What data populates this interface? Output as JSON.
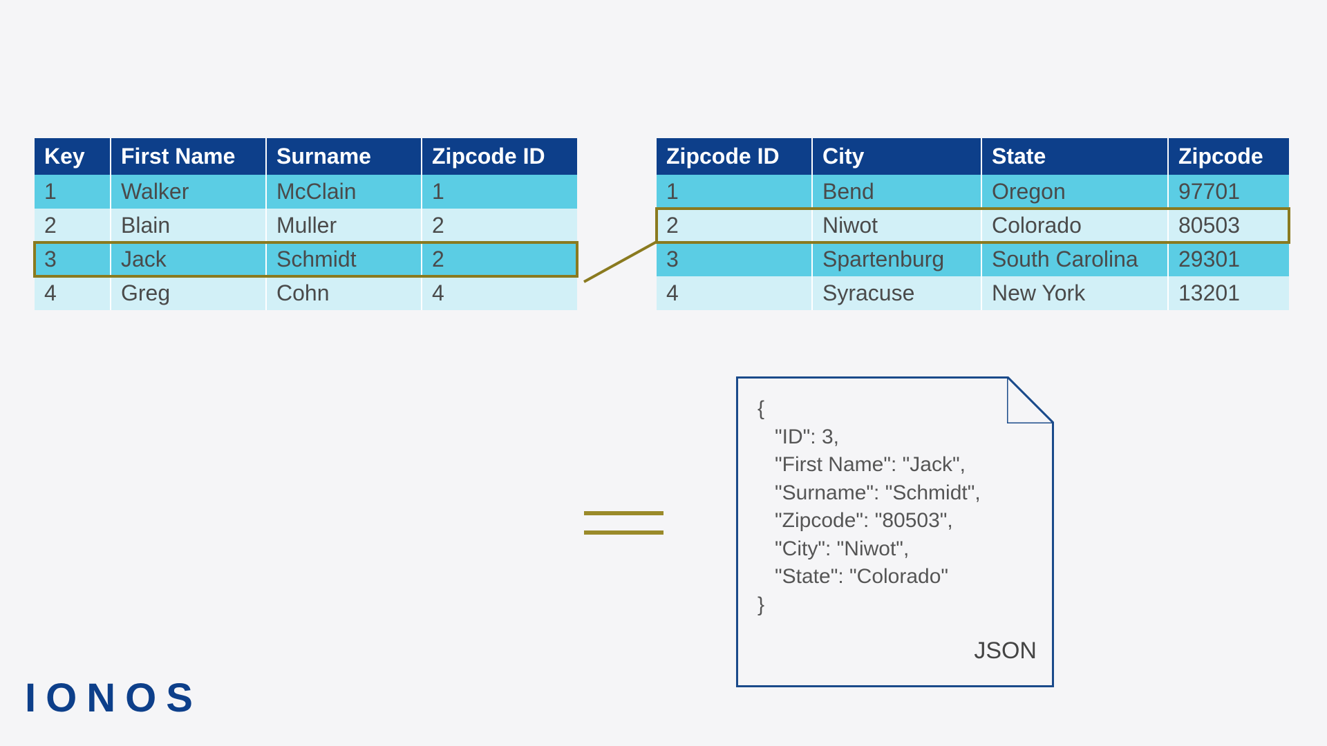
{
  "persons_table": {
    "headers": [
      "Key",
      "First Name",
      "Surname",
      "Zipcode ID"
    ],
    "rows": [
      {
        "cells": [
          "1",
          "Walker",
          "McClain",
          "1"
        ],
        "shade": "mid",
        "highlight": false
      },
      {
        "cells": [
          "2",
          "Blain",
          "Muller",
          "2"
        ],
        "shade": "light",
        "highlight": false
      },
      {
        "cells": [
          "3",
          "Jack",
          "Schmidt",
          "2"
        ],
        "shade": "mid",
        "highlight": true
      },
      {
        "cells": [
          "4",
          "Greg",
          "Cohn",
          "4"
        ],
        "shade": "light",
        "highlight": false
      }
    ]
  },
  "zip_table": {
    "headers": [
      "Zipcode ID",
      "City",
      "State",
      "Zipcode"
    ],
    "rows": [
      {
        "cells": [
          "1",
          "Bend",
          "Oregon",
          "97701"
        ],
        "shade": "mid",
        "highlight": false
      },
      {
        "cells": [
          "2",
          "Niwot",
          "Colorado",
          "80503"
        ],
        "shade": "light",
        "highlight": true
      },
      {
        "cells": [
          "3",
          "Spartenburg",
          "South Carolina",
          "29301"
        ],
        "shade": "mid",
        "highlight": false
      },
      {
        "cells": [
          "4",
          "Syracuse",
          "New York",
          "13201"
        ],
        "shade": "light",
        "highlight": false
      }
    ]
  },
  "json_document": {
    "lines": [
      "{",
      "   \"ID\": 3,",
      "   \"First Name\": \"Jack\",",
      "   \"Surname\": \"Schmidt\",",
      "   \"Zipcode\": \"80503\",",
      "   \"City\": \"Niwot\",",
      "   \"State\": \"Colorado\"",
      "}"
    ],
    "label": "JSON"
  },
  "logo": "IONOS",
  "colors": {
    "header_bg": "#0d3f8a",
    "row_mid": "#5bcde4",
    "row_light": "#d2f0f7",
    "highlight_border": "#8a7a1f",
    "accent_olive": "#9a8a2a"
  }
}
